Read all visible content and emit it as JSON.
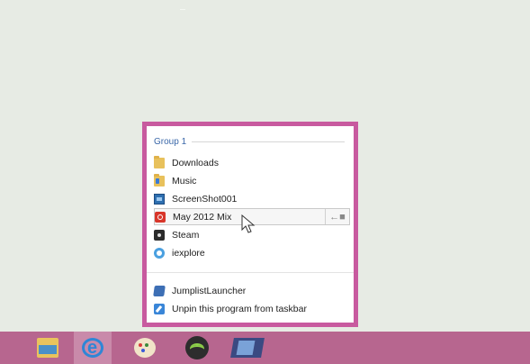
{
  "jumplist": {
    "group_title": "Group 1",
    "items": [
      {
        "label": "Downloads",
        "icon": "folder-icon"
      },
      {
        "label": "Music",
        "icon": "music-folder-icon"
      },
      {
        "label": "ScreenShot001",
        "icon": "image-file-icon"
      },
      {
        "label": "May 2012 Mix",
        "icon": "media-file-icon"
      },
      {
        "label": "Steam",
        "icon": "steam-icon"
      },
      {
        "label": "iexplore",
        "icon": "internet-explorer-icon"
      }
    ],
    "tasks": [
      {
        "label": "JumplistLauncher",
        "icon": "jumplist-launcher-icon"
      },
      {
        "label": "Unpin this program from taskbar",
        "icon": "unpin-icon"
      }
    ],
    "border_color": "#c85a9f"
  },
  "taskbar": {
    "color": "#b7668f",
    "apps": [
      {
        "name": "File Explorer",
        "icon": "file-explorer-icon"
      },
      {
        "name": "Internet Explorer",
        "icon": "internet-explorer-icon"
      },
      {
        "name": "Paint",
        "icon": "paint-palette-icon"
      },
      {
        "name": "Spotify",
        "icon": "spotify-icon"
      },
      {
        "name": "JumplistLauncher",
        "icon": "jumplist-launcher-icon"
      }
    ]
  }
}
